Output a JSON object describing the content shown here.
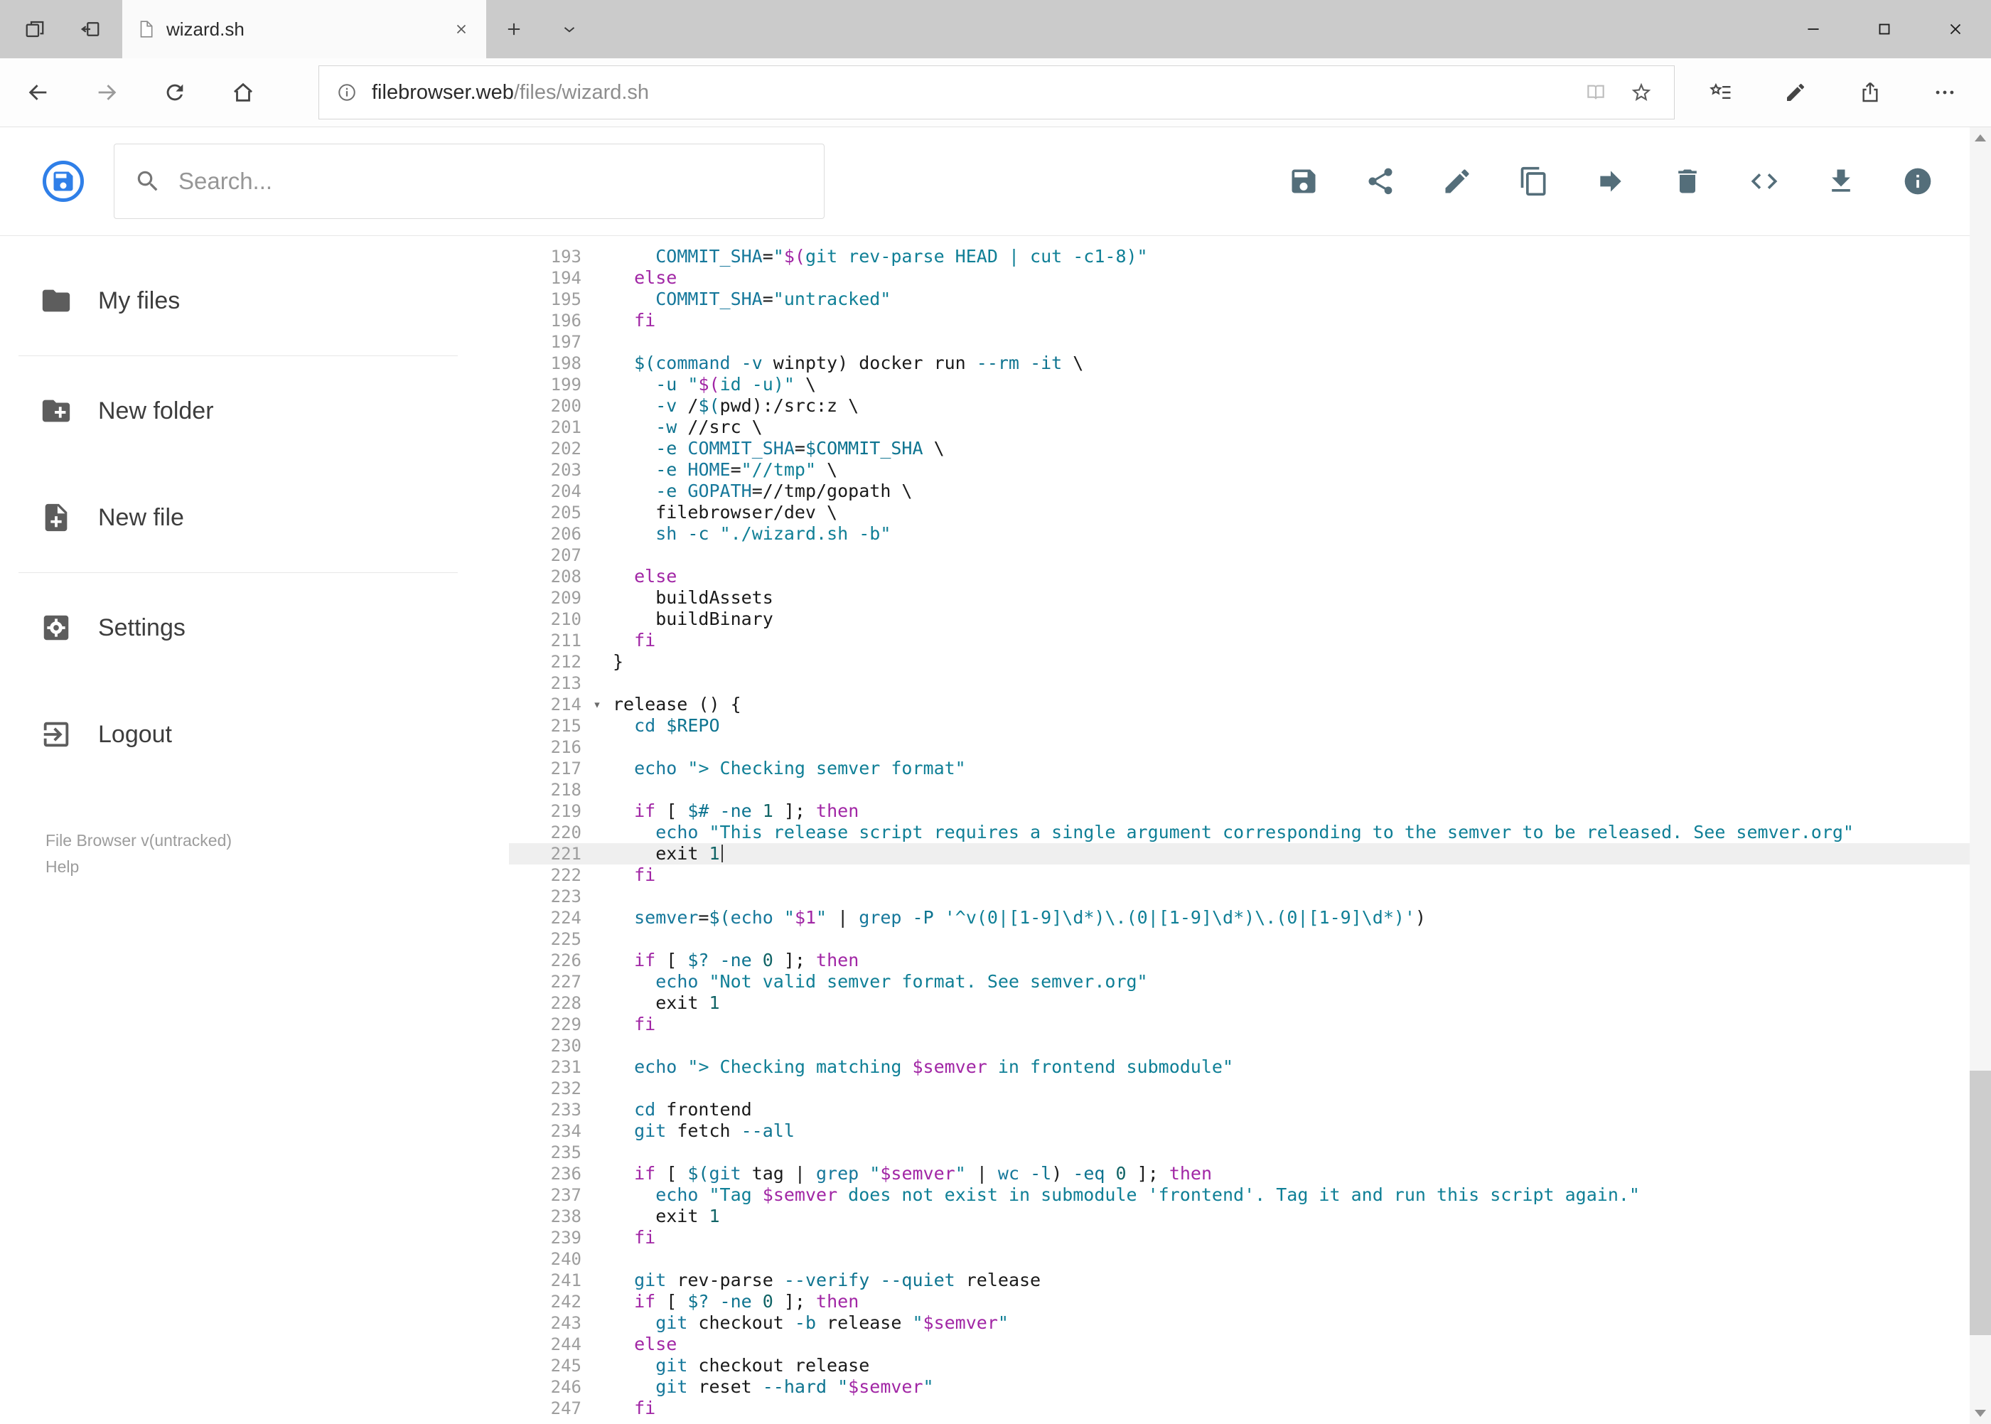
{
  "browser": {
    "tab": {
      "title": "wizard.sh"
    },
    "address": {
      "host": "filebrowser.web",
      "path": "/files/wizard.sh"
    }
  },
  "app": {
    "search_placeholder": "Search...",
    "toolbar": [
      {
        "name": "save",
        "icon": "floppy-icon"
      },
      {
        "name": "share",
        "icon": "share-nodes-icon"
      },
      {
        "name": "rename",
        "icon": "pencil-icon"
      },
      {
        "name": "copy",
        "icon": "copy-icon"
      },
      {
        "name": "move",
        "icon": "arrow-forward-icon"
      },
      {
        "name": "delete",
        "icon": "trash-icon"
      },
      {
        "name": "editor-mode",
        "icon": "code-icon"
      },
      {
        "name": "download",
        "icon": "download-icon"
      },
      {
        "name": "info",
        "icon": "info-icon"
      }
    ],
    "sidebar": {
      "groups": [
        [
          {
            "name": "my-files",
            "label": "My files",
            "icon": "folder-icon"
          }
        ],
        [
          {
            "name": "new-folder",
            "label": "New folder",
            "icon": "folder-plus-icon"
          },
          {
            "name": "new-file",
            "label": "New file",
            "icon": "file-plus-icon"
          }
        ],
        [
          {
            "name": "settings",
            "label": "Settings",
            "icon": "settings-icon"
          },
          {
            "name": "logout",
            "label": "Logout",
            "icon": "logout-icon"
          }
        ]
      ],
      "footer": {
        "version": "File Browser v(untracked)",
        "help": "Help"
      }
    }
  },
  "editor": {
    "first_line": 193,
    "active_line": 221,
    "fold_lines": [
      214
    ],
    "lines": [
      "    COMMIT_SHA=\"$(git rev-parse HEAD | cut -c1-8)\"",
      "  else",
      "    COMMIT_SHA=\"untracked\"",
      "  fi",
      "",
      "  $(command -v winpty) docker run --rm -it \\",
      "    -u \"$(id -u)\" \\",
      "    -v /$(pwd):/src:z \\",
      "    -w //src \\",
      "    -e COMMIT_SHA=$COMMIT_SHA \\",
      "    -e HOME=\"//tmp\" \\",
      "    -e GOPATH=//tmp/gopath \\",
      "    filebrowser/dev \\",
      "    sh -c \"./wizard.sh -b\"",
      "",
      "  else",
      "    buildAssets",
      "    buildBinary",
      "  fi",
      "}",
      "",
      "release () {",
      "  cd $REPO",
      "",
      "  echo \"> Checking semver format\"",
      "",
      "  if [ $# -ne 1 ]; then",
      "    echo \"This release script requires a single argument corresponding to the semver to be released. See semver.org\"",
      "    exit 1",
      "  fi",
      "",
      "  semver=$(echo \"$1\" | grep -P '^v(0|[1-9]\\d*)\\.(0|[1-9]\\d*)\\.(0|[1-9]\\d*)')",
      "",
      "  if [ $? -ne 0 ]; then",
      "    echo \"Not valid semver format. See semver.org\"",
      "    exit 1",
      "  fi",
      "",
      "  echo \"> Checking matching $semver in frontend submodule\"",
      "",
      "  cd frontend",
      "  git fetch --all",
      "",
      "  if [ $(git tag | grep \"$semver\" | wc -l) -eq 0 ]; then",
      "    echo \"Tag $semver does not exist in submodule 'frontend'. Tag it and run this script again.\"",
      "    exit 1",
      "  fi",
      "",
      "  git rev-parse --verify --quiet release",
      "  if [ $? -ne 0 ]; then",
      "    git checkout -b release \"$semver\"",
      "  else",
      "    git checkout release",
      "    git reset --hard \"$semver\"",
      "  fi"
    ]
  },
  "colors": {
    "logo_blue": "#2f7fe8",
    "toolbar_icon": "#546e7a",
    "active_line_bg": "#efefef",
    "syntax": {
      "keyword": "#a126a5",
      "string": "#0f7f96",
      "command": "#16789b",
      "definition": "#16789b",
      "variable": "#0e7490",
      "number": "#116466"
    }
  }
}
